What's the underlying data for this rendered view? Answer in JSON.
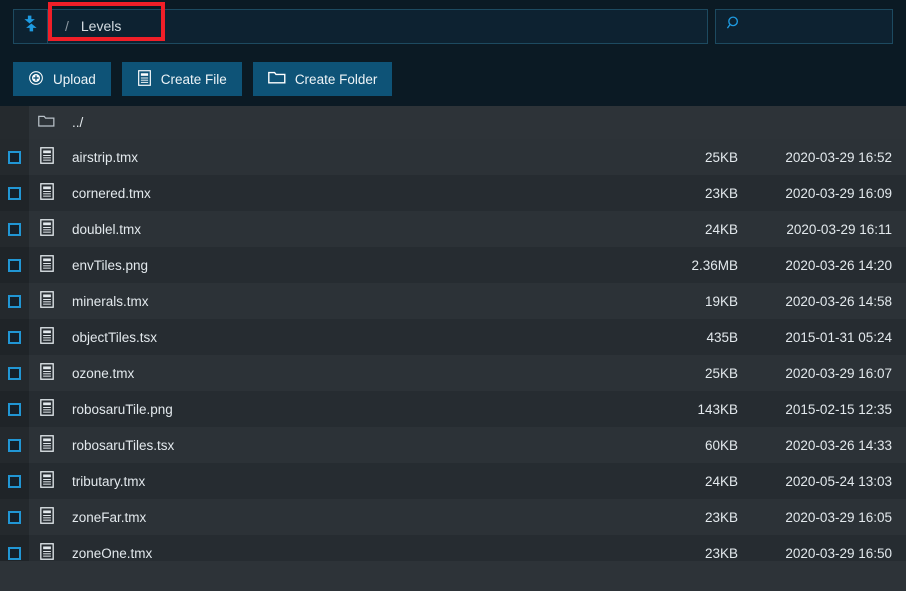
{
  "header": {
    "logo_icon": "sync-arrows-icon",
    "breadcrumb": {
      "separator": "/",
      "current": "Levels"
    },
    "search": {
      "icon": "search-icon",
      "value": "",
      "placeholder": ""
    }
  },
  "toolbar": {
    "buttons": [
      {
        "label": "Upload",
        "icon": "upload-circle-plus-icon"
      },
      {
        "label": "Create File",
        "icon": "document-icon"
      },
      {
        "label": "Create Folder",
        "icon": "folder-icon"
      }
    ]
  },
  "filelist": {
    "parent": {
      "name": "../",
      "icon": "folder-icon"
    },
    "rows": [
      {
        "name": "airstrip.tmx",
        "size": "25KB",
        "date": "2020-03-29 16:52",
        "icon": "file-icon",
        "checked": false
      },
      {
        "name": "cornered.tmx",
        "size": "23KB",
        "date": "2020-03-29 16:09",
        "icon": "file-icon",
        "checked": false
      },
      {
        "name": "doublel.tmx",
        "size": "24KB",
        "date": "2020-03-29 16:11",
        "icon": "file-icon",
        "checked": false
      },
      {
        "name": "envTiles.png",
        "size": "2.36MB",
        "date": "2020-03-26 14:20",
        "icon": "file-icon",
        "checked": false
      },
      {
        "name": "minerals.tmx",
        "size": "19KB",
        "date": "2020-03-26 14:58",
        "icon": "file-icon",
        "checked": false
      },
      {
        "name": "objectTiles.tsx",
        "size": "435B",
        "date": "2015-01-31 05:24",
        "icon": "file-icon",
        "checked": false
      },
      {
        "name": "ozone.tmx",
        "size": "25KB",
        "date": "2020-03-29 16:07",
        "icon": "file-icon",
        "checked": false
      },
      {
        "name": "robosaruTile.png",
        "size": "143KB",
        "date": "2015-02-15 12:35",
        "icon": "file-icon",
        "checked": false
      },
      {
        "name": "robosaruTiles.tsx",
        "size": "60KB",
        "date": "2020-03-26 14:33",
        "icon": "file-icon",
        "checked": false
      },
      {
        "name": "tributary.tmx",
        "size": "24KB",
        "date": "2020-05-24 13:03",
        "icon": "file-icon",
        "checked": false
      },
      {
        "name": "zoneFar.tmx",
        "size": "23KB",
        "date": "2020-03-29 16:05",
        "icon": "file-icon",
        "checked": false
      },
      {
        "name": "zoneOne.tmx",
        "size": "23KB",
        "date": "2020-03-29 16:50",
        "icon": "file-icon",
        "checked": false
      }
    ]
  },
  "annotation": {
    "highlight_color": "#f01f28",
    "target": "breadcrumb"
  },
  "colors": {
    "header_bg": "#0b1a24",
    "accent_blue": "#2196d4",
    "button_bg": "#0e5377",
    "row_odd": "#2c3237",
    "row_even": "#262c31"
  }
}
